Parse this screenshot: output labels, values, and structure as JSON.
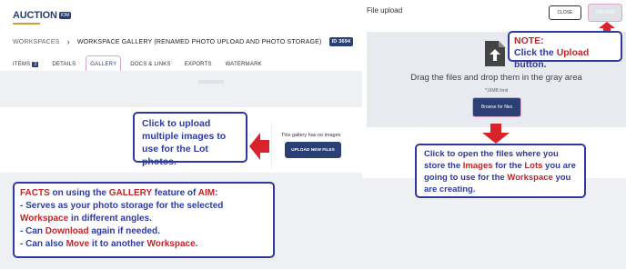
{
  "logo": {
    "word": "AUCTION",
    "badge": "IOM"
  },
  "breadcrumb": {
    "root": "WORKSPACES",
    "separator": "›",
    "current": "WORKSPACE GALLERY (RENAMED PHOTO UPLOAD AND PHOTO STORAGE)",
    "id": "ID 3694"
  },
  "tabs": [
    {
      "label": "ITEMS",
      "count": "3"
    },
    {
      "label": "DETAILS"
    },
    {
      "label": "GALLERY"
    },
    {
      "label": "DOCS & LINKS"
    },
    {
      "label": "EXPORTS"
    },
    {
      "label": "WATERMARK"
    }
  ],
  "gallery": {
    "empty_text": "This gallery has no images",
    "upload_button": "UPLOAD NEW FILES"
  },
  "modal": {
    "title": "File upload",
    "close_label": "CLOSE",
    "upload_label": "UPLOAD",
    "drop_text": "Drag the files and drop them in the gray area",
    "limit": "*16MB limit",
    "browse_label": "Browse for files"
  },
  "callouts": {
    "upload_multiple": "Click to upload multiple images to use for the Lot photos.",
    "note_label": "NOTE:",
    "note_pre": "Click the ",
    "note_em": "Upload",
    "note_post": " button.",
    "open_files": {
      "p1": "Click to open the files where you store the ",
      "images": "Images",
      "p2": " for the ",
      "lots": "Lots",
      "p3": " you are going to use for the ",
      "workspace": "Workspace",
      "p4": " you are creating."
    },
    "facts": {
      "facts": "FACTS",
      "p1": " on using the ",
      "gallery": "GALLERY",
      "p2": " feature of ",
      "aim": "AIM",
      "p3": ":",
      "line2a": "- Serves as your photo storage for the selected ",
      "workspace": "Workspace",
      "line2b": " in different angles.",
      "line3a": "- Can ",
      "download": "Download",
      "line3b": " again if needed.",
      "line4a": "- Can also ",
      "move": "Move",
      "line4b": " it to another ",
      "workspace2": "Workspace",
      "line4c": "."
    }
  },
  "colors": {
    "navy": "#2a3f73",
    "callout_blue": "#2e3a9e",
    "highlight_red": "#c0262a",
    "arrow_red": "#d9232b",
    "pink_outline": "#d9a5c9"
  }
}
